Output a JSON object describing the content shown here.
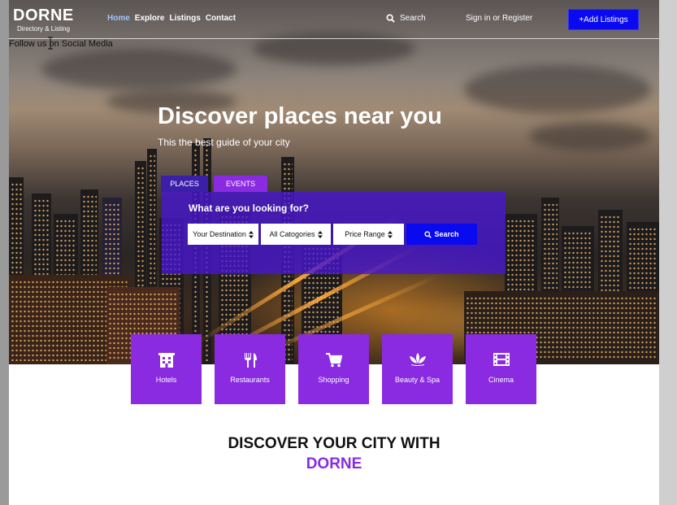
{
  "header": {
    "logo": "DORNE",
    "tagline": "Directory & Listing",
    "nav": [
      "Home",
      "Explore",
      "Listings",
      "Contact"
    ],
    "active_nav": "Home",
    "search_label": "Search",
    "signin_label": "Sign in or Register",
    "add_listing_label": "+Add Listings"
  },
  "social": {
    "follow_text": "Follow us on Social Media"
  },
  "hero": {
    "title": "Discover places near you",
    "subtitle": "This the best guide of your city",
    "tabs": [
      "PLACES",
      "EVENTS"
    ],
    "search_question": "What are you looking for?",
    "selects": [
      {
        "label": "Your Destination"
      },
      {
        "label": "All Catogories"
      },
      {
        "label": "Price Range"
      }
    ],
    "search_button": "Search"
  },
  "categories": [
    {
      "label": "Hotels",
      "icon": "hotel-icon"
    },
    {
      "label": "Restaurants",
      "icon": "fork-knife-icon"
    },
    {
      "label": "Shopping",
      "icon": "cart-icon"
    },
    {
      "label": "Beauty & Spa",
      "icon": "lotus-icon"
    },
    {
      "label": "Cinema",
      "icon": "film-icon"
    }
  ],
  "discover": {
    "line1": "DISCOVER YOUR CITY WITH",
    "line2": "DORNE"
  },
  "colors": {
    "primary": "#8a2be2",
    "accent_blue": "#0a0af0",
    "tab_dark": "#3b1fa8"
  }
}
